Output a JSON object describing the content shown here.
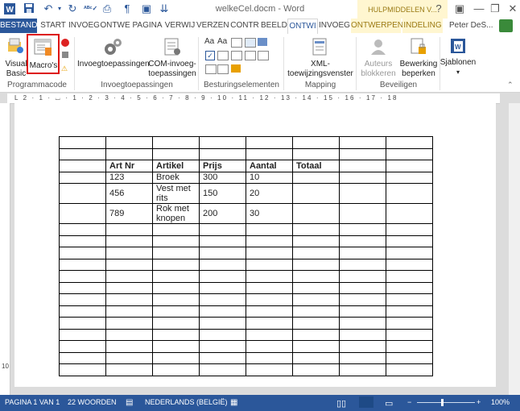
{
  "window": {
    "title": "welkeCel.docm - Word",
    "context_title": "HULPMIDDELEN V...",
    "help": "?"
  },
  "tabs": [
    {
      "label": "BESTAND"
    },
    {
      "label": "START"
    },
    {
      "label": "INVOEG"
    },
    {
      "label": "ONTWE"
    },
    {
      "label": "PAGINA"
    },
    {
      "label": "VERWIJ"
    },
    {
      "label": "VERZEN"
    },
    {
      "label": "CONTR"
    },
    {
      "label": "BEELD"
    },
    {
      "label": "ONTWI"
    },
    {
      "label": "INVOEG"
    },
    {
      "label": "ONTWERPEN"
    },
    {
      "label": "INDELING"
    }
  ],
  "user": "Peter DeS...",
  "ribbon": {
    "vb_label": "Visual\nBasic",
    "macros_label": "Macro's",
    "programmacode": "Programmacode",
    "invoeg1": "Invoegtoepassingen",
    "invoeg2": "COM-invoeg-\ntoepassingen",
    "invoeg_group": "Invoegtoepassingen",
    "besturing_group": "Besturingselementen",
    "xml_label": "XML-\ntoewijzingsvenster",
    "mapping_group": "Mapping",
    "auteurs_label": "Auteurs\nblokkeren",
    "bewerking_label": "Bewerking\nbeperken",
    "beveiligen_group": "Beveiligen",
    "sjablonen_label": "Sjablonen"
  },
  "ruler": "L  2 · 1 · ⌴ · 1 · 2 · 3 · 4 · 5 · 6 · 7 · 8 · 9 · 10 · 11 · 12 · 13 · 14 · 15 · 16 · 17 · 18",
  "vruler_mark": "10",
  "table": {
    "header": [
      "Art Nr",
      "Artikel",
      "Prijs",
      "Aantal",
      "Totaal"
    ],
    "rows": [
      [
        "123",
        "Broek",
        "300",
        "10"
      ],
      [
        "456",
        "Vest met rits",
        "150",
        "20"
      ],
      [
        "789",
        "Rok met knopen",
        "200",
        "30"
      ]
    ]
  },
  "status": {
    "page": "PAGINA 1 VAN 1",
    "words": "22 WOORDEN",
    "language": "NEDERLANDS (BELGIË)",
    "zoom": "100%"
  },
  "colors": {
    "word_blue": "#2b579a",
    "contextual_gold": "#9a7a14",
    "highlight_red": "#d11111"
  }
}
